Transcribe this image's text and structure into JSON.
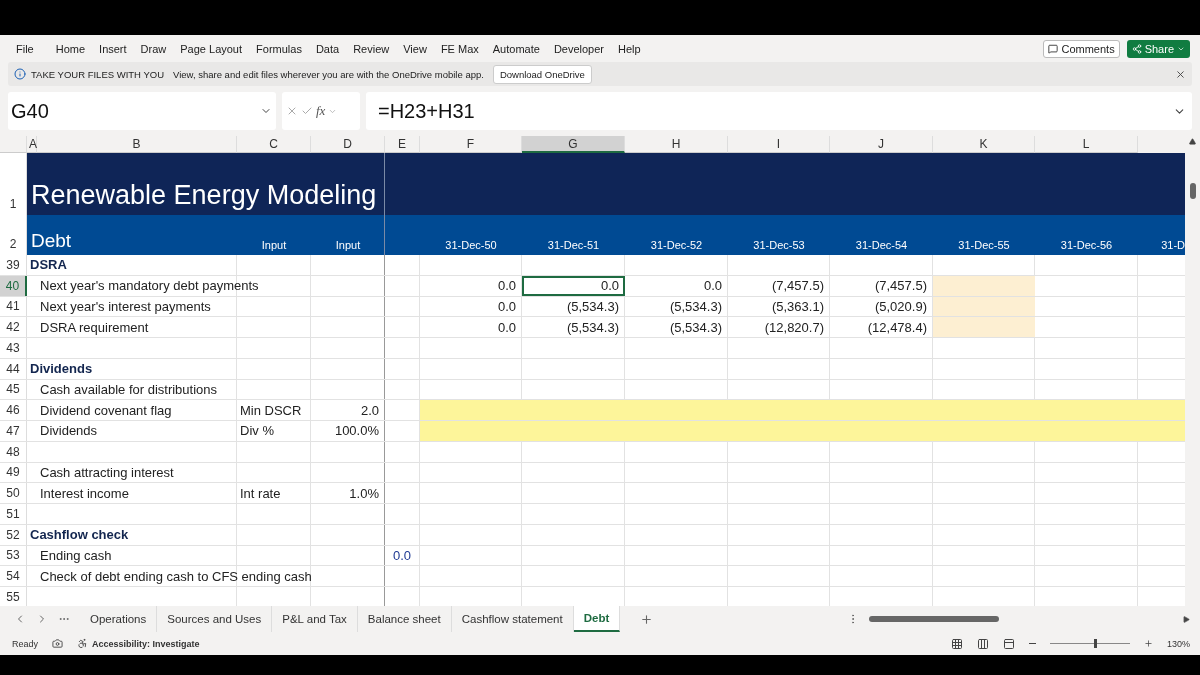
{
  "menu": [
    "File",
    "Home",
    "Insert",
    "Draw",
    "Page Layout",
    "Formulas",
    "Data",
    "Review",
    "View",
    "FE Max",
    "Automate",
    "Developer",
    "Help"
  ],
  "header_buttons": {
    "comments": "Comments",
    "share": "Share"
  },
  "info_bar": {
    "title": "TAKE YOUR FILES WITH YOU",
    "message": "View, share and edit files wherever you are with the OneDrive mobile app.",
    "button": "Download OneDrive"
  },
  "formula_bar": {
    "name_box": "G40",
    "fx_label": "fx",
    "formula": "=H23+H31"
  },
  "columns": [
    {
      "label": "A",
      "selected": false
    },
    {
      "label": "B",
      "selected": false
    },
    {
      "label": "C",
      "selected": false
    },
    {
      "label": "D",
      "selected": false
    },
    {
      "label": "E",
      "selected": false
    },
    {
      "label": "F",
      "selected": false
    },
    {
      "label": "G",
      "selected": true
    },
    {
      "label": "H",
      "selected": false
    },
    {
      "label": "I",
      "selected": false
    },
    {
      "label": "J",
      "selected": false
    },
    {
      "label": "K",
      "selected": false
    },
    {
      "label": "L",
      "selected": false
    }
  ],
  "title_row": {
    "number": "1",
    "title": "Renewable Energy Modeling"
  },
  "subtitle_row": {
    "number": "2",
    "title": "Debt",
    "input_labels": [
      "Input",
      "Input"
    ],
    "dates": [
      "31-Dec-50",
      "31-Dec-51",
      "31-Dec-52",
      "31-Dec-53",
      "31-Dec-54",
      "31-Dec-55",
      "31-Dec-56",
      "31-D"
    ]
  },
  "rows": [
    {
      "number": "39",
      "kind": "section",
      "label": "DSRA",
      "selected": false
    },
    {
      "number": "40",
      "kind": "item",
      "label": "Next year's mandatory debt payments",
      "selected": true,
      "color": "#fdefd2",
      "values": [
        {
          "text": "0.0",
          "selected": false
        },
        {
          "text": "0.0",
          "selected": true
        },
        {
          "text": "0.0",
          "selected": false
        },
        {
          "text": "(7,457.5)",
          "selected": false
        },
        {
          "text": "(7,457.5)",
          "selected": false
        }
      ]
    },
    {
      "number": "41",
      "kind": "item",
      "label": "Next year's interest payments",
      "selected": false,
      "color": "#fdefd2",
      "values": [
        {
          "text": "0.0",
          "selected": false
        },
        {
          "text": "(5,534.3)",
          "selected": false
        },
        {
          "text": "(5,534.3)",
          "selected": false
        },
        {
          "text": "(5,363.1)",
          "selected": false
        },
        {
          "text": "(5,020.9)",
          "selected": false
        }
      ]
    },
    {
      "number": "42",
      "kind": "item",
      "label": "DSRA requirement",
      "selected": false,
      "color": "#fdefd2",
      "values": [
        {
          "text": "0.0",
          "selected": false
        },
        {
          "text": "(5,534.3)",
          "selected": false
        },
        {
          "text": "(5,534.3)",
          "selected": false
        },
        {
          "text": "(12,820.7)",
          "selected": false
        },
        {
          "text": "(12,478.4)",
          "selected": false
        }
      ]
    },
    {
      "number": "43",
      "kind": "blank",
      "selected": false
    },
    {
      "number": "44",
      "kind": "section",
      "label": "Dividends",
      "selected": false
    },
    {
      "number": "45",
      "kind": "item",
      "label": "Cash available for distributions",
      "selected": false
    },
    {
      "number": "46",
      "kind": "item",
      "label": "Dividend covenant flag",
      "input_label": "Min DSCR",
      "input": "2.0",
      "selected": false,
      "color": "#fdf59a"
    },
    {
      "number": "47",
      "kind": "item",
      "label": "Dividends",
      "input_label": "Div %",
      "input": "100.0%",
      "selected": false,
      "color": "#fdf59a"
    },
    {
      "number": "48",
      "kind": "blank",
      "selected": false
    },
    {
      "number": "49",
      "kind": "item",
      "label": "Cash attracting interest",
      "selected": false
    },
    {
      "number": "50",
      "kind": "item",
      "label": "Interest income",
      "input_label": "Int rate",
      "input": "1.0%",
      "selected": false
    },
    {
      "number": "51",
      "kind": "blank",
      "selected": false
    },
    {
      "number": "52",
      "kind": "section",
      "label": "Cashflow check",
      "selected": false
    },
    {
      "number": "53",
      "kind": "item",
      "label": "Ending cash",
      "check_value": "0.0",
      "selected": false
    },
    {
      "number": "54",
      "kind": "item",
      "label": "Check of debt ending cash to CFS ending cash",
      "selected": false
    },
    {
      "number": "55",
      "kind": "blank",
      "selected": false
    }
  ],
  "sheet_tabs": [
    {
      "label": "Operations",
      "selected": false
    },
    {
      "label": "Sources and Uses",
      "selected": false
    },
    {
      "label": "P&L and Tax",
      "selected": false
    },
    {
      "label": "Balance sheet",
      "selected": false
    },
    {
      "label": "Cashflow statement",
      "selected": false
    },
    {
      "label": "Debt",
      "selected": true
    }
  ],
  "status_bar": {
    "status": "Ready",
    "accessibility": "Accessibility: Investigate",
    "zoom": "130%",
    "zoom_level": {
      "level": 0.55
    }
  }
}
